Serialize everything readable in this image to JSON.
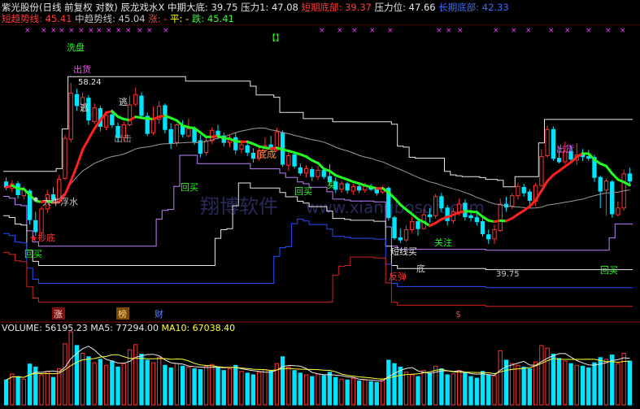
{
  "header": {
    "line1": [
      {
        "text": "紫光股份(日线 前复权 对数) 辰龙戏水X",
        "color": "#e6e6e6"
      },
      {
        "text": "中期大底: 39.75",
        "color": "#e6e6e6"
      },
      {
        "text": "压力1: 47.08",
        "color": "#e6e6e6"
      },
      {
        "text": "短期底部: 39.37",
        "color": "#ff3b3b"
      },
      {
        "text": "压力位: 47.66",
        "color": "#e6e6e6"
      },
      {
        "text": "长期底部: 42.33",
        "color": "#3a6bff"
      }
    ],
    "line2": [
      {
        "text": "短趋势线: 45.41",
        "color": "#ff3b3b"
      },
      {
        "text": "中趋势线: 45.04",
        "color": "#c8c8c8"
      },
      {
        "text": "涨: -",
        "color": "#ff3b3b"
      },
      {
        "text": "平: -",
        "color": "#ffff00"
      },
      {
        "text": "跌: 45.41",
        "color": "#33ff33"
      }
    ]
  },
  "labels": {
    "wash": "洗盘",
    "ship_left": "出货",
    "peak": "58.24",
    "escape1": "逃",
    "escape2": "逃",
    "crash": "出击",
    "bottom_form": "底成",
    "buy_back1": "回买",
    "buy_back2": "回买",
    "buy_back3": "回买",
    "buy_back4": "回买",
    "buy_mid": "买",
    "dry_water": "大牛浮水",
    "bottom_pick": "抄底",
    "short_line": "短线买",
    "focus": "关注",
    "rebound": "反弹",
    "bottom2": "底",
    "low": "39.75",
    "ship_right": "出货",
    "zhang": "涨",
    "bang": "榜",
    "cai": "财",
    "s_marker": "$",
    "bracket": "【】"
  },
  "watermark": {
    "cn": "翔博软件",
    "url": "www.xiangbosoft.com"
  },
  "volume": {
    "label": "VOLUME: 56195.23",
    "ma5": "MA5: 77294.00",
    "ma10": "MA10: 67038.40",
    "ma5_value": 77294.0,
    "ma10_value": 67038.4
  },
  "chart_data": {
    "type": "candlestick",
    "title": "紫光股份(日线 前复权 对数)",
    "scale": "log",
    "ylim": [
      34,
      62
    ],
    "candles": [
      [
        45.8,
        45.2,
        46.3,
        44.9
      ],
      [
        45.1,
        45.6,
        46.0,
        44.7
      ],
      [
        45.6,
        44.4,
        45.9,
        44.0
      ],
      [
        44.3,
        44.9,
        45.3,
        43.9
      ],
      [
        44.8,
        41.8,
        45.0,
        41.3
      ],
      [
        41.7,
        40.6,
        42.6,
        40.2
      ],
      [
        40.5,
        42.9,
        43.2,
        39.8
      ],
      [
        42.9,
        44.4,
        44.9,
        42.5
      ],
      [
        44.4,
        43.8,
        45.2,
        43.4
      ],
      [
        43.7,
        46.1,
        46.6,
        43.5
      ],
      [
        46.2,
        50.9,
        51.3,
        46.0
      ],
      [
        50.8,
        56.8,
        58.24,
        50.4
      ],
      [
        56.6,
        55.1,
        57.4,
        54.4
      ],
      [
        55.2,
        56.2,
        56.9,
        54.2
      ],
      [
        56.1,
        53.2,
        56.5,
        52.6
      ],
      [
        53.0,
        54.8,
        55.4,
        52.7
      ],
      [
        54.7,
        52.4,
        55.1,
        51.8
      ],
      [
        52.3,
        53.8,
        54.1,
        51.9
      ],
      [
        53.9,
        52.6,
        54.6,
        52.2
      ],
      [
        52.4,
        51.0,
        52.9,
        50.4
      ],
      [
        51.0,
        52.6,
        53.0,
        50.5
      ],
      [
        52.6,
        55.2,
        56.4,
        52.4
      ],
      [
        55.3,
        56.6,
        57.6,
        55.0
      ],
      [
        56.4,
        53.8,
        56.9,
        53.3
      ],
      [
        53.7,
        51.5,
        54.2,
        51.2
      ],
      [
        51.6,
        53.4,
        55.0,
        51.3
      ],
      [
        53.3,
        55.0,
        55.7,
        52.7
      ],
      [
        55.1,
        52.0,
        55.4,
        51.5
      ],
      [
        52.0,
        50.3,
        52.8,
        49.6
      ],
      [
        50.4,
        52.6,
        52.8,
        49.9
      ],
      [
        52.5,
        51.4,
        53.2,
        51.0
      ],
      [
        51.2,
        52.1,
        53.4,
        51.0
      ],
      [
        52.1,
        50.5,
        52.4,
        50.1
      ],
      [
        50.6,
        49.1,
        51.3,
        48.6
      ],
      [
        49.2,
        50.6,
        51.2,
        48.8
      ],
      [
        50.6,
        51.9,
        52.3,
        50.2
      ],
      [
        51.8,
        51.3,
        52.6,
        50.8
      ],
      [
        51.2,
        50.4,
        51.6,
        49.9
      ],
      [
        50.4,
        50.9,
        51.3,
        49.8
      ],
      [
        51.0,
        49.5,
        51.6,
        49.0
      ],
      [
        49.6,
        50.1,
        50.7,
        49.1
      ],
      [
        50.0,
        49.2,
        50.3,
        48.8
      ],
      [
        49.1,
        48.5,
        49.7,
        48.0
      ],
      [
        48.5,
        49.4,
        49.8,
        48.2
      ],
      [
        49.4,
        50.0,
        51.0,
        49.1
      ],
      [
        50.1,
        49.6,
        51.2,
        49.2
      ],
      [
        49.5,
        51.7,
        52.2,
        49.3
      ],
      [
        51.6,
        47.8,
        51.9,
        47.5
      ],
      [
        47.7,
        48.8,
        49.2,
        47.0
      ],
      [
        48.9,
        47.6,
        49.1,
        47.3
      ],
      [
        47.4,
        46.8,
        47.9,
        46.5
      ],
      [
        46.8,
        47.3,
        47.7,
        46.3
      ],
      [
        47.2,
        46.4,
        47.5,
        45.9
      ],
      [
        46.4,
        47.1,
        47.6,
        46.0
      ],
      [
        47.1,
        46.4,
        47.3,
        46.1
      ],
      [
        46.4,
        45.8,
        47.8,
        45.4
      ],
      [
        45.8,
        45.0,
        46.3,
        44.6
      ],
      [
        45.0,
        45.6,
        45.9,
        44.6
      ],
      [
        45.6,
        44.9,
        45.8,
        44.5
      ],
      [
        44.8,
        45.3,
        45.6,
        44.4
      ],
      [
        45.3,
        44.9,
        45.5,
        44.6
      ],
      [
        44.9,
        45.4,
        45.7,
        44.6
      ],
      [
        45.3,
        45.0,
        45.6,
        44.8
      ],
      [
        45.0,
        44.6,
        45.2,
        44.3
      ],
      [
        44.7,
        45.1,
        45.4,
        44.5
      ],
      [
        45.1,
        42.0,
        45.3,
        41.7
      ],
      [
        42.0,
        40.0,
        42.2,
        39.8
      ],
      [
        40.0,
        39.8,
        40.9,
        39.5
      ],
      [
        39.8,
        40.8,
        41.2,
        39.6
      ],
      [
        40.8,
        41.6,
        42.1,
        40.5
      ],
      [
        41.6,
        40.9,
        41.9,
        40.2
      ],
      [
        40.9,
        42.3,
        42.9,
        40.8
      ],
      [
        42.3,
        42.1,
        43.0,
        41.5
      ],
      [
        42.2,
        44.2,
        44.5,
        41.9
      ],
      [
        44.2,
        43.0,
        44.6,
        42.6
      ],
      [
        43.0,
        41.7,
        43.3,
        41.2
      ],
      [
        41.7,
        42.6,
        43.0,
        41.4
      ],
      [
        42.6,
        43.4,
        44.0,
        42.2
      ],
      [
        43.5,
        42.1,
        43.9,
        41.7
      ],
      [
        42.2,
        42.0,
        42.7,
        41.6
      ],
      [
        42.0,
        41.6,
        42.5,
        41.2
      ],
      [
        41.6,
        40.4,
        42.0,
        40.1
      ],
      [
        40.3,
        39.9,
        40.8,
        39.4
      ],
      [
        39.9,
        40.8,
        41.3,
        39.4
      ],
      [
        40.7,
        43.4,
        44.0,
        40.6
      ],
      [
        43.4,
        43.1,
        44.2,
        42.6
      ],
      [
        43.2,
        44.3,
        44.6,
        42.9
      ],
      [
        44.3,
        45.3,
        45.7,
        43.9
      ],
      [
        45.2,
        44.6,
        45.6,
        44.2
      ],
      [
        44.7,
        43.8,
        45.0,
        43.1
      ],
      [
        43.7,
        45.4,
        45.7,
        43.2
      ],
      [
        45.4,
        48.7,
        49.6,
        45.3
      ],
      [
        48.8,
        52.0,
        52.5,
        48.6
      ],
      [
        52.0,
        48.5,
        52.4,
        48.2
      ],
      [
        48.5,
        48.1,
        49.9,
        47.9
      ],
      [
        48.1,
        49.3,
        50.5,
        47.8
      ],
      [
        49.3,
        48.4,
        50.0,
        48.0
      ],
      [
        48.3,
        48.9,
        50.3,
        47.7
      ],
      [
        48.9,
        48.7,
        49.6,
        48.2
      ],
      [
        48.7,
        48.5,
        49.5,
        48.2
      ],
      [
        48.6,
        46.3,
        48.9,
        45.8
      ],
      [
        46.3,
        44.8,
        46.5,
        43.0
      ],
      [
        44.9,
        45.9,
        46.2,
        42.2
      ],
      [
        45.8,
        42.4,
        46.0,
        42.0
      ],
      [
        42.3,
        43.0,
        43.7,
        42.1
      ],
      [
        43.0,
        46.7,
        47.2,
        42.7
      ],
      [
        46.7,
        45.9,
        47.4,
        45.5
      ]
    ],
    "volume": [
      58,
      72,
      66,
      60,
      95,
      88,
      70,
      78,
      64,
      84,
      142,
      170,
      138,
      120,
      112,
      98,
      106,
      92,
      102,
      88,
      96,
      128,
      140,
      118,
      104,
      98,
      110,
      92,
      86,
      96,
      90,
      88,
      84,
      82,
      90,
      94,
      86,
      80,
      84,
      92,
      78,
      74,
      70,
      76,
      82,
      80,
      96,
      112,
      88,
      80,
      74,
      70,
      66,
      72,
      68,
      76,
      64,
      60,
      58,
      62,
      56,
      58,
      54,
      52,
      60,
      104,
      96,
      88,
      76,
      70,
      66,
      80,
      74,
      90,
      84,
      70,
      72,
      80,
      76,
      66,
      62,
      78,
      70,
      68,
      126,
      104,
      96,
      92,
      88,
      84,
      100,
      138,
      132,
      118,
      108,
      102,
      96,
      92,
      90,
      86,
      98,
      110,
      106,
      116,
      96,
      120,
      102
    ],
    "ma5_vol": 77294.0,
    "ma10_vol": 67038.4,
    "xlabel": "",
    "ylabel": ""
  }
}
